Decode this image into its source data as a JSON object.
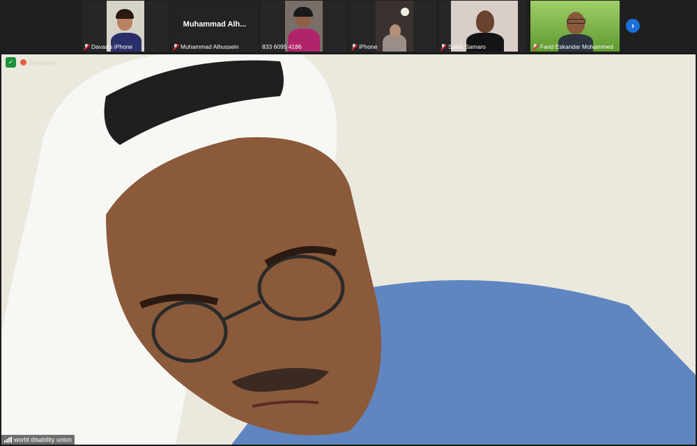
{
  "participants": [
    {
      "name": "Davaa's iPhone",
      "muted": true
    },
    {
      "name": "Muhammad Alhussein",
      "display_name": "Muhammad  Alh...",
      "muted": true
    },
    {
      "name": "833 6095 4186",
      "muted": false
    },
    {
      "name": "iPhone",
      "muted": true
    },
    {
      "name": "Salah Samaro",
      "muted": true
    },
    {
      "name": "Farid Eskandar Mohammed",
      "muted": true
    }
  ],
  "strip": {
    "next_icon": "chevron-right-icon",
    "next_glyph": "›"
  },
  "main_video": {
    "speaker_label": "world disability union",
    "recording_label": "Recording",
    "shield_icon": "shield-check-icon",
    "shield_glyph": "✓"
  },
  "colors": {
    "accent": "#1b6fd6",
    "recording": "#e65d3c",
    "security": "#1d8f3a",
    "mute": "#ee2233"
  }
}
